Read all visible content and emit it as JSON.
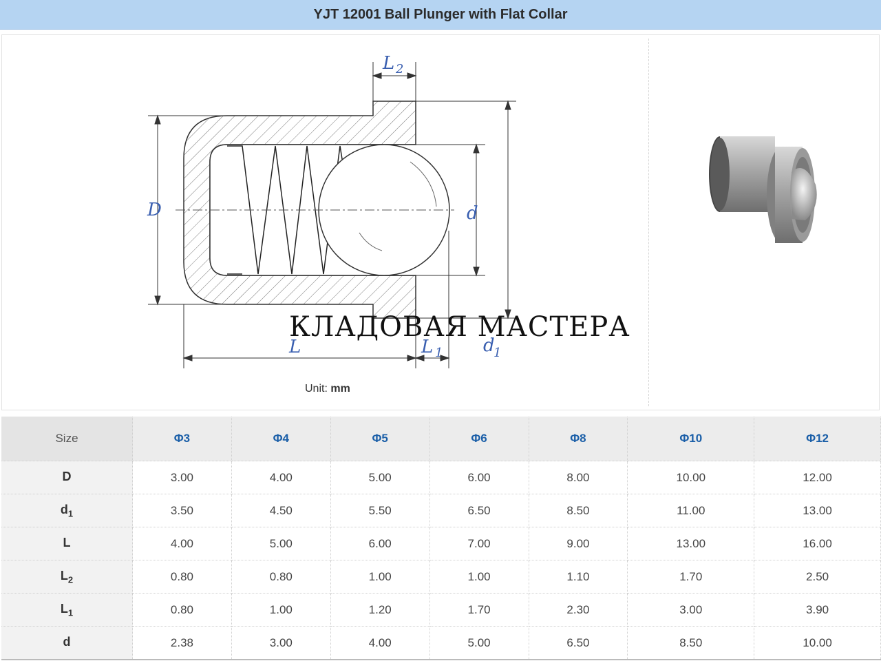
{
  "header": {
    "title": "YJT 12001 Ball Plunger with Flat Collar"
  },
  "drawing": {
    "labels": {
      "L2_main": "L",
      "L2_sub": "2",
      "D": "D",
      "d": "d",
      "L": "L",
      "L1_main": "L",
      "L1_sub": "1",
      "d1_main": "d",
      "d1_sub": "1"
    },
    "unit_prefix": "Unit:",
    "unit_value": "mm",
    "watermark": "КЛАДОВАЯ МАСТЕРА",
    "product_image": "ball-plunger-3d-icon"
  },
  "table": {
    "corner": "Size",
    "columns": [
      "Φ3",
      "Φ4",
      "Φ5",
      "Φ6",
      "Φ8",
      "Φ10",
      "Φ12"
    ],
    "rows": [
      {
        "main": "D",
        "sub": "",
        "values": [
          "3.00",
          "4.00",
          "5.00",
          "6.00",
          "8.00",
          "10.00",
          "12.00"
        ]
      },
      {
        "main": "d",
        "sub": "1",
        "values": [
          "3.50",
          "4.50",
          "5.50",
          "6.50",
          "8.50",
          "11.00",
          "13.00"
        ]
      },
      {
        "main": "L",
        "sub": "",
        "values": [
          "4.00",
          "5.00",
          "6.00",
          "7.00",
          "9.00",
          "13.00",
          "16.00"
        ]
      },
      {
        "main": "L",
        "sub": "2",
        "values": [
          "0.80",
          "0.80",
          "1.00",
          "1.00",
          "1.10",
          "1.70",
          "2.50"
        ]
      },
      {
        "main": "L",
        "sub": "1",
        "values": [
          "0.80",
          "1.00",
          "1.20",
          "1.70",
          "2.30",
          "3.00",
          "3.90"
        ]
      },
      {
        "main": "d",
        "sub": "",
        "values": [
          "2.38",
          "3.00",
          "4.00",
          "5.00",
          "6.50",
          "8.50",
          "10.00"
        ]
      }
    ]
  },
  "colors": {
    "header_bg": "#b5d4f2",
    "label_blue": "#3a5fb0",
    "column_blue": "#1b5fa8"
  }
}
